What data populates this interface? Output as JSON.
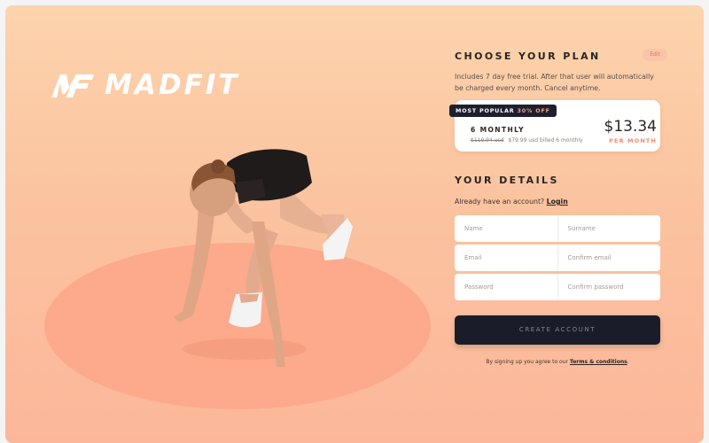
{
  "brand": {
    "logo_text": "MADFIT",
    "logo_mark": "MF"
  },
  "plan": {
    "title": "CHOOSE YOUR PLAN",
    "edit_label": "Edit",
    "description": "Includes 7 day free trial. After that user will automatically be charged every month. Cancel anytime.",
    "badge_text": "MOST POPULAR",
    "badge_discount": "30% OFF",
    "name": "6 MONTHLY",
    "old_price": "$119.94 usd",
    "billed_text": "$79.99 usd billed 6 monthly",
    "price": "$13.34",
    "period": "PER MONTH"
  },
  "details": {
    "title": "YOUR DETAILS",
    "account_prompt": "Already have an account?",
    "login_label": "Login",
    "fields": {
      "name": "Name",
      "surname": "Surname",
      "email": "Email",
      "confirm_email": "Confirm email",
      "password": "Password",
      "confirm_password": "Confirm password"
    },
    "create_label": "CREATE ACCOUNT",
    "terms_prefix": "By signing up you agree to our",
    "terms_link": "Terms & conditions",
    "terms_suffix": "."
  },
  "colors": {
    "accent": "#ef8b68",
    "dark": "#1b1c29",
    "floor": "#fda98b"
  }
}
